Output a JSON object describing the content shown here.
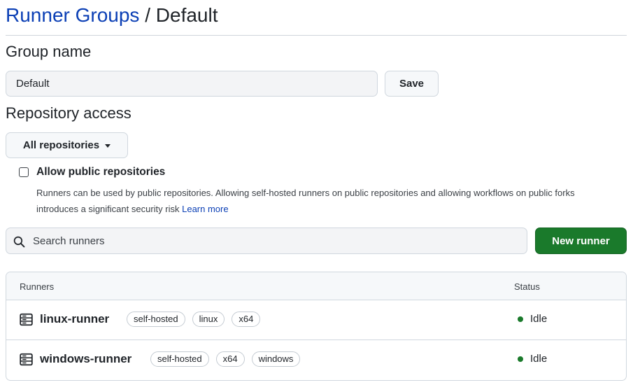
{
  "breadcrumb": {
    "parent": "Runner Groups",
    "separator": "/",
    "current": "Default"
  },
  "group_name": {
    "heading": "Group name",
    "value": "Default",
    "save_label": "Save"
  },
  "repository_access": {
    "heading": "Repository access",
    "selected": "All repositories",
    "allow_public_label": "Allow public repositories",
    "allow_public_checked": false,
    "help_text": "Runners can be used by public repositories. Allowing self-hosted runners on public repositories and allowing workflows on public forks introduces a significant security risk",
    "learn_more": "Learn more"
  },
  "search": {
    "placeholder": "Search runners"
  },
  "new_runner_label": "New runner",
  "table": {
    "columns": {
      "runners": "Runners",
      "status": "Status"
    },
    "rows": [
      {
        "name": "linux-runner",
        "labels": [
          "self-hosted",
          "linux",
          "x64"
        ],
        "status": "Idle"
      },
      {
        "name": "windows-runner",
        "labels": [
          "self-hosted",
          "x64",
          "windows"
        ],
        "status": "Idle"
      }
    ]
  },
  "icons": {
    "search": "search-icon",
    "runner": "server-icon",
    "dropdown": "caret-down-icon",
    "status": "status-dot-icon"
  },
  "colors": {
    "link": "#0b3fb5",
    "primary": "#1a7a2b",
    "status_idle": "#1a7a2b"
  }
}
